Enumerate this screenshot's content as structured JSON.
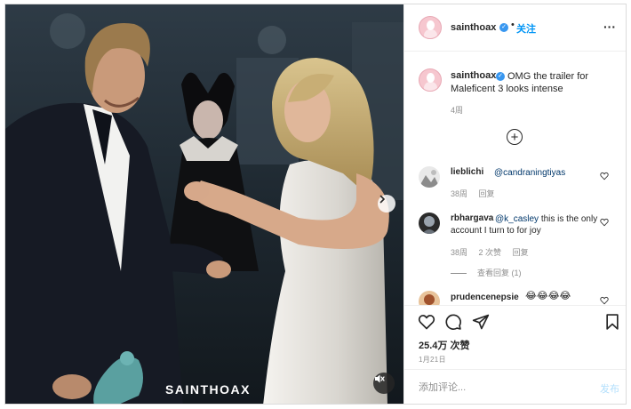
{
  "post": {
    "author": "sainthoax",
    "follow_label": "关注",
    "dot": "•",
    "more_label": "···",
    "watermark": "SAINTHOAX",
    "caption": {
      "username": "sainthoax",
      "text": "OMG the trailer for Maleficent 3 looks intense",
      "time": "4周"
    },
    "load_more": "+",
    "comments": [
      {
        "username": "lieblichi",
        "mention": "@candraningtiyas",
        "text": "",
        "time": "38周",
        "reply_label": "回复",
        "likes_label": ""
      },
      {
        "username": "rbhargava",
        "mention": "@k_casley",
        "text": " this is the only account I turn to for joy",
        "time": "38周",
        "likes_label": "2 次赞",
        "reply_label": "回复",
        "view_replies": "查看回复 (1)"
      },
      {
        "username": "prudencenepsie",
        "mention": "",
        "text": "😂😂😂😂",
        "time": "",
        "reply_label": ""
      }
    ],
    "likes": "25.4万 次赞",
    "date": "1月21日",
    "comment_placeholder": "添加评论...",
    "post_button": "发布"
  },
  "colors": {
    "link_blue": "#0095f6",
    "post_disabled": "#b2dffc",
    "verified_blue": "#3897f0",
    "muted_text": "#8e8e8e",
    "border": "#dbdbdb"
  },
  "icons": {
    "next": "chevron-right-icon",
    "mute": "speaker-muted-icon",
    "like": "heart-icon",
    "comment": "comment-bubble-icon",
    "share": "paper-plane-icon",
    "save": "bookmark-icon",
    "add": "plus-circle-icon"
  }
}
